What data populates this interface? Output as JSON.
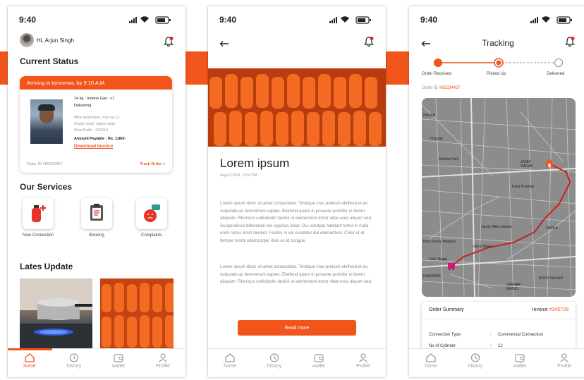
{
  "status_bar": {
    "time": "9:40"
  },
  "colors": {
    "accent": "#f2551b",
    "map_bg": "#8c8c8c",
    "route": "#cc1f1f"
  },
  "nav": {
    "home": "home",
    "history": "history",
    "wallet": "wallet",
    "profile": "Profile"
  },
  "screen1": {
    "greeting": "Hi, Arjun Singh",
    "current_status_heading": "Current Status",
    "banner": "Arriving in tomorrow, by 9:10 A.M.",
    "product": "14 kg - Indane Gas - x1",
    "state": "Delivering",
    "address_line1": "Mira apartment, Flat no.12",
    "address_line2": "Akash road, Jahar bagh",
    "address_line3": "New Delhi - 110010",
    "amount": "Amount Payable : Rs. 1180/-",
    "download": "Download Invoice",
    "order_id": "Order ID #65234457",
    "track_order": "Track Order >",
    "services_heading": "Our Services",
    "services": [
      {
        "label": "New Connection"
      },
      {
        "label": "Booking"
      },
      {
        "label": "Complaints"
      }
    ],
    "updates_heading": "Lates Update"
  },
  "screen2": {
    "title": "Lorem ipsum",
    "date": "Aug,03,2024, 12:53 PM",
    "para1": "Lorem ipsum dolor sit amet consectetur. Tristique cras pretium eleifend et eu vulputate ac fermentum sapien. Eleifend quam in posuere porttitor ut lorem aliquam. Rhoncus sollicitudin facilisi ut elementum tortor vitae eros aliquet sed. Suspendisse bibendum leo egestas dolor. Dui volutpat habitant tortor in nulla enim netus enim laoreet. Facilisi in vel curabitur dui elementum. Color ut et tempor morbi ullamcorper duis ac id congue.",
    "para2": "Lorem ipsum dolor sit amet consectetur. Tristique cras pretium eleifend et eu vulputate ac fermentum sapien. Eleifend quam in posuere porttitor ut lorem aliquam. Rhoncus sollicitudin facilisi ut elementum tortor vitae eros aliquet sed.",
    "read_more": "Read more"
  },
  "screen3": {
    "title": "Tracking",
    "steps": [
      {
        "label": "Order Received",
        "state": "done"
      },
      {
        "label": "Picked Up",
        "state": "current"
      },
      {
        "label": "Delivered",
        "state": "pending"
      }
    ],
    "order_id_label": "Order ID",
    "order_id": "#65234457",
    "map_labels": {
      "nasad": "NASAD",
      "hospital": "... Hospital",
      "ashoka_park": "Ashoka Park",
      "jamia_nagar": "JAMIA\nNAGAR",
      "batla_hospital": "Batla Hospital",
      "jamia_islamia": "Jamia Millia Islamia",
      "okhla": "OKHLA",
      "holy_family": "Holy Family Hospital",
      "jamia_masjid": "Jama Masjid",
      "kashpasi": "KASHPASI",
      "zakir": "Zakir Nagar",
      "kalindi": "Kalindi",
      "gaffar": "GAFFAR\nMANZIL",
      "noor": "NOOR NAGAR"
    },
    "summary_title": "Order Summary",
    "invoice_label": "Invoice",
    "invoice_no": "#345728",
    "rows": [
      {
        "key": "Connection Type",
        "colon": ":",
        "value": "Commercial Connection"
      },
      {
        "key": "No of Cylinder",
        "colon": ":",
        "value": "12"
      }
    ]
  }
}
